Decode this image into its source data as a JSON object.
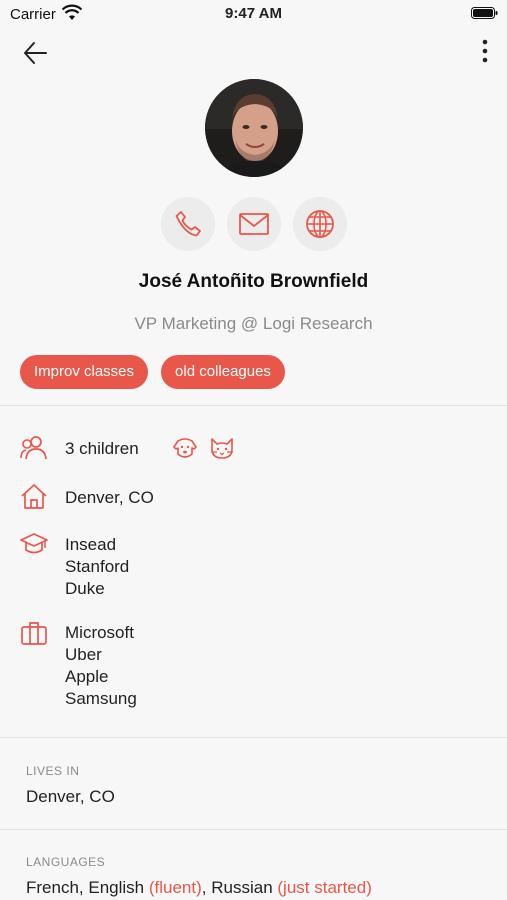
{
  "status_bar": {
    "carrier": "Carrier",
    "time": "9:47 AM"
  },
  "header": {
    "back_icon": "back-arrow-icon",
    "more_icon": "more-vertical-icon"
  },
  "profile": {
    "name": "José Antoñito Brownfield",
    "subtitle": "VP Marketing @ Logi Research",
    "tags": [
      "Improv classes",
      "old colleagues"
    ],
    "actions": [
      "phone-icon",
      "mail-icon",
      "globe-icon"
    ]
  },
  "details": {
    "children": "3 children",
    "pets": [
      "dog-icon",
      "cat-icon"
    ],
    "home": "Denver, CO",
    "education": [
      "Insead",
      "Stanford",
      "Duke"
    ],
    "work": [
      "Microsoft",
      "Uber",
      "Apple",
      "Samsung"
    ]
  },
  "lives_in": {
    "label": "LIVES IN",
    "value": "Denver, CO"
  },
  "languages": {
    "label": "LANGUAGES",
    "part1": "French, English",
    "level1": "(fluent)",
    "part2": ", Russian",
    "level2": "(just started)"
  },
  "colors": {
    "accent": "#e8574a",
    "background": "#f7f7f7",
    "muted": "#8a8a8a"
  }
}
